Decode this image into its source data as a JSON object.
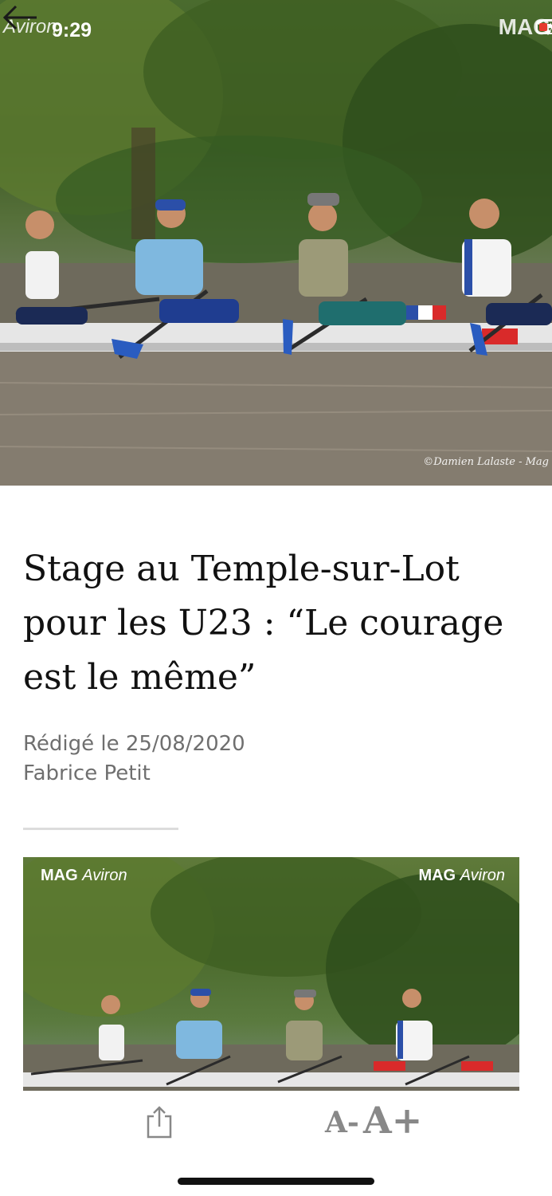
{
  "status_bar": {
    "time": "9:29"
  },
  "hero": {
    "watermark_left": "Aviron",
    "watermark_right": "MAG",
    "photo_credit": "©Damien Lalaste - Mag"
  },
  "article": {
    "title": "Stage au Temple-sur-Lot pour les U23 : “Le courage est le même”",
    "date_line": "Rédigé le 25/08/2020",
    "author": "Fabrice Petit"
  },
  "inline_photo": {
    "watermark_brand": "MAG",
    "watermark_name": "Aviron"
  },
  "toolbar": {
    "font_smaller_label": "A-",
    "font_larger_label": "A+"
  },
  "colors": {
    "title": "#111111",
    "meta": "#6f6f6f",
    "toolbar_icon": "#888888"
  }
}
